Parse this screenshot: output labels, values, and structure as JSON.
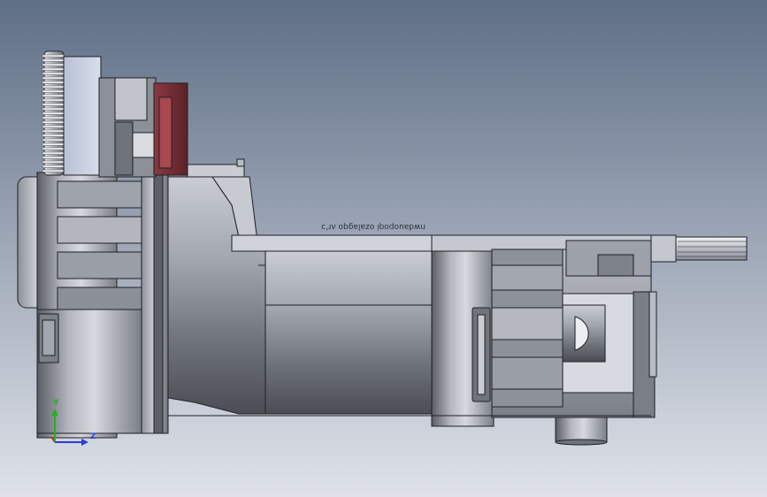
{
  "viewport": {
    "background_top": "#5f6f86",
    "background_bottom": "#dfe2e9"
  },
  "model": {
    "engraved_text": "nwdauopoqi ozalagqo ʌr'ɔ"
  },
  "triad": {
    "y_label": "Y",
    "z_label": "Z",
    "colors": {
      "x": "#d62020",
      "y": "#22b022",
      "z": "#2a3cd8"
    }
  }
}
